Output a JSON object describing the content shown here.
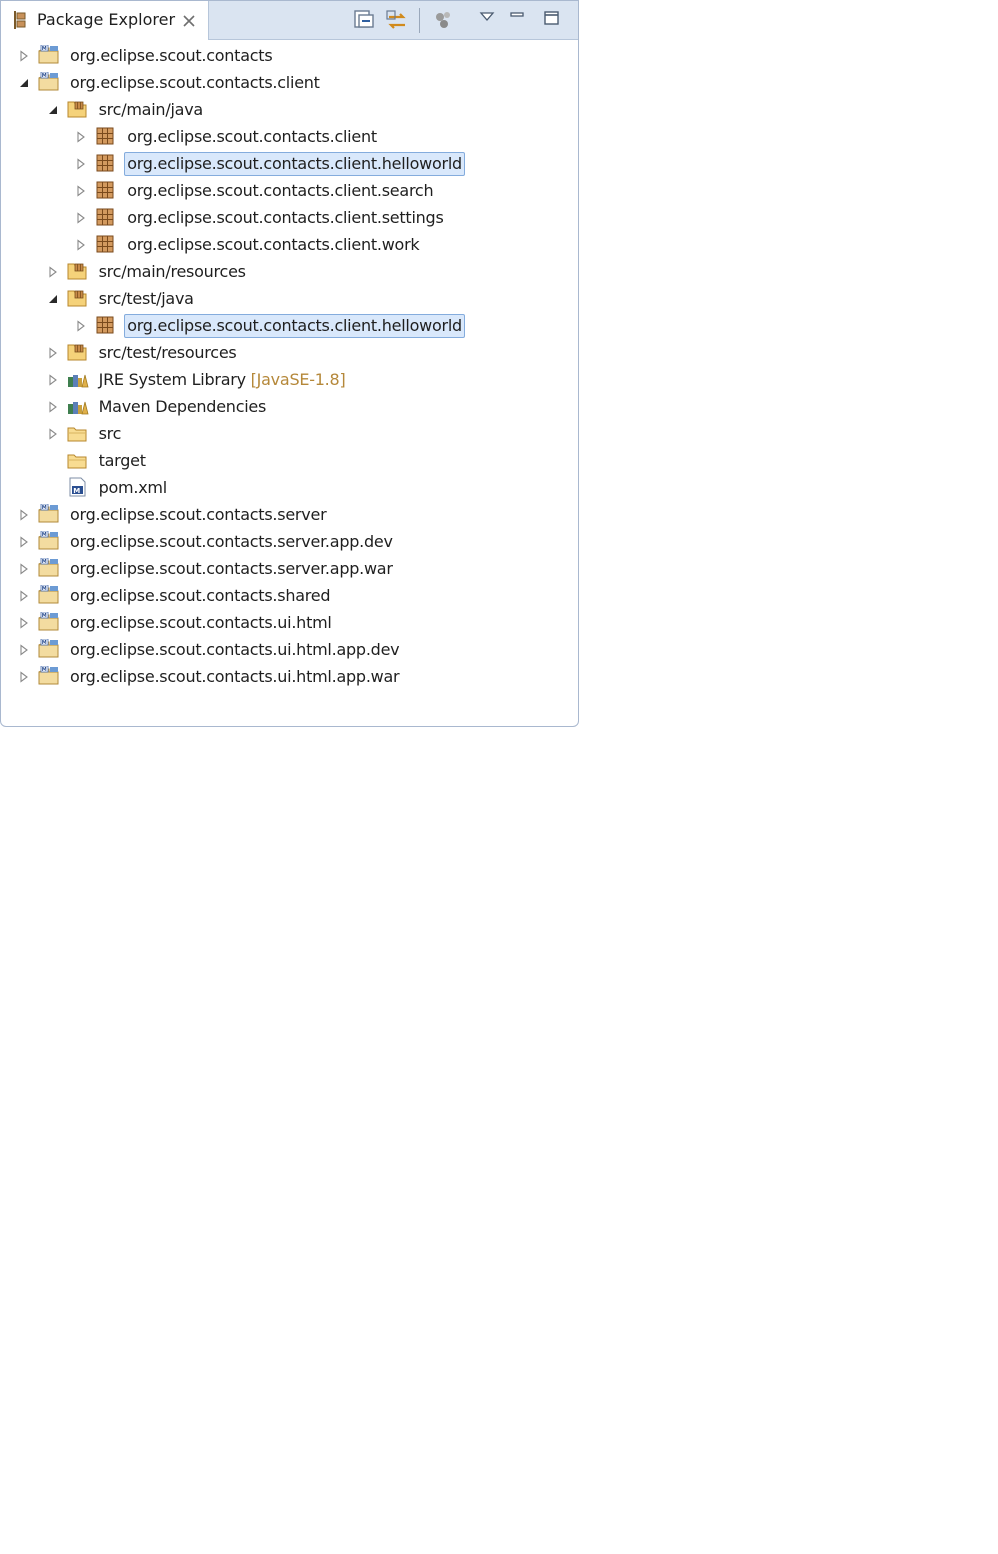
{
  "view": {
    "title": "Package Explorer",
    "colors": {
      "title_bar": "#dae4f1",
      "selection": "#d9e8fb",
      "selection_border": "#84acdd",
      "decoration": "#b5883a"
    },
    "toolbar": [
      {
        "icon": "collapse-all-icon"
      },
      {
        "icon": "link-with-editor-icon"
      },
      {
        "icon": "focus-active-task-icon"
      },
      {
        "icon": "view-menu-icon"
      },
      {
        "icon": "minimize-icon"
      },
      {
        "icon": "maximize-icon"
      }
    ]
  },
  "tree": [
    {
      "label": "org.eclipse.scout.contacts",
      "icon": "project-icon",
      "state": "collapsed"
    },
    {
      "label": "org.eclipse.scout.contacts.client",
      "icon": "project-icon",
      "state": "expanded"
    },
    {
      "label": "src/main/java",
      "icon": "source-folder-icon",
      "state": "expanded"
    },
    {
      "label": "org.eclipse.scout.contacts.client",
      "icon": "package-icon",
      "state": "collapsed"
    },
    {
      "label": "org.eclipse.scout.contacts.client.helloworld",
      "icon": "package-icon",
      "state": "collapsed",
      "selected": true
    },
    {
      "label": "org.eclipse.scout.contacts.client.search",
      "icon": "package-icon",
      "state": "collapsed"
    },
    {
      "label": "org.eclipse.scout.contacts.client.settings",
      "icon": "package-icon",
      "state": "collapsed"
    },
    {
      "label": "org.eclipse.scout.contacts.client.work",
      "icon": "package-icon",
      "state": "collapsed"
    },
    {
      "label": "src/main/resources",
      "icon": "source-folder-icon",
      "state": "collapsed"
    },
    {
      "label": "src/test/java",
      "icon": "source-folder-icon",
      "state": "expanded"
    },
    {
      "label": "org.eclipse.scout.contacts.client.helloworld",
      "icon": "package-icon",
      "state": "collapsed",
      "selected": true
    },
    {
      "label": "src/test/resources",
      "icon": "source-folder-icon",
      "state": "collapsed"
    },
    {
      "label": "JRE System Library",
      "decoration": "[JavaSE-1.8]",
      "icon": "library-icon",
      "state": "collapsed"
    },
    {
      "label": "Maven Dependencies",
      "icon": "library-icon",
      "state": "collapsed"
    },
    {
      "label": "src",
      "icon": "folder-icon",
      "state": "collapsed"
    },
    {
      "label": "target",
      "icon": "folder-icon",
      "state": "leaf"
    },
    {
      "label": "pom.xml",
      "icon": "maven-file-icon",
      "state": "leaf"
    },
    {
      "label": "org.eclipse.scout.contacts.server",
      "icon": "project-icon",
      "state": "collapsed"
    },
    {
      "label": "org.eclipse.scout.contacts.server.app.dev",
      "icon": "project-icon",
      "state": "collapsed"
    },
    {
      "label": "org.eclipse.scout.contacts.server.app.war",
      "icon": "project-icon",
      "state": "collapsed"
    },
    {
      "label": "org.eclipse.scout.contacts.shared",
      "icon": "project-icon",
      "state": "collapsed"
    },
    {
      "label": "org.eclipse.scout.contacts.ui.html",
      "icon": "project-icon",
      "state": "collapsed"
    },
    {
      "label": "org.eclipse.scout.contacts.ui.html.app.dev",
      "icon": "project-icon",
      "state": "collapsed"
    },
    {
      "label": "org.eclipse.scout.contacts.ui.html.app.war",
      "icon": "project-icon",
      "state": "collapsed"
    }
  ]
}
